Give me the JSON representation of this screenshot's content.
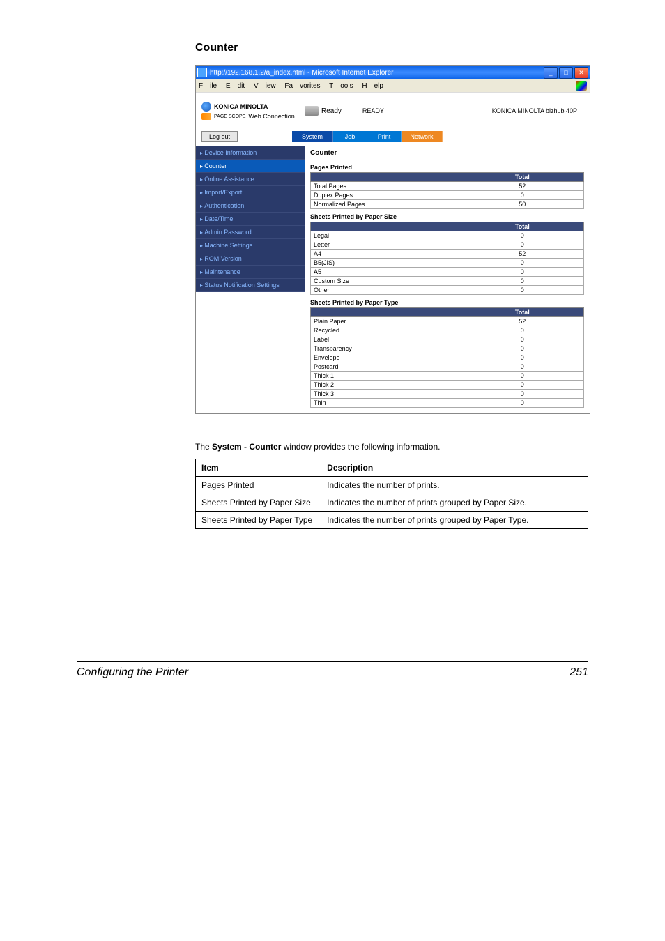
{
  "page": {
    "heading": "Counter"
  },
  "browser": {
    "title": "http://192.168.1.2/a_index.html - Microsoft Internet Explorer",
    "menus": [
      "File",
      "Edit",
      "View",
      "Favorites",
      "Tools",
      "Help"
    ]
  },
  "brand": {
    "name": "KONICA MINOLTA",
    "page_scope": "PAGE SCOPE",
    "web_conn": "Web Connection",
    "status": "Ready",
    "ready": "READY",
    "model": "KONICA MINOLTA bizhub 40P"
  },
  "logout": "Log out",
  "tabs": {
    "system": "System",
    "job": "Job",
    "print": "Print",
    "network": "Network"
  },
  "sidebar": [
    "Device Information",
    "Counter",
    "Online Assistance",
    "Import/Export",
    "Authentication",
    "Date/Time",
    "Admin Password",
    "Machine Settings",
    "ROM Version",
    "Maintenance",
    "Status Notification Settings"
  ],
  "panel": {
    "title": "Counter",
    "sections": {
      "pages": {
        "title": "Pages Printed",
        "total_hdr": "Total",
        "rows": [
          {
            "label": "Total Pages",
            "value": "52"
          },
          {
            "label": "Duplex Pages",
            "value": "0"
          },
          {
            "label": "Normalized Pages",
            "value": "50"
          }
        ]
      },
      "size": {
        "title": "Sheets Printed by Paper Size",
        "total_hdr": "Total",
        "rows": [
          {
            "label": "Legal",
            "value": "0"
          },
          {
            "label": "Letter",
            "value": "0"
          },
          {
            "label": "A4",
            "value": "52"
          },
          {
            "label": "B5(JIS)",
            "value": "0"
          },
          {
            "label": "A5",
            "value": "0"
          },
          {
            "label": "Custom Size",
            "value": "0"
          },
          {
            "label": "Other",
            "value": "0"
          }
        ]
      },
      "type": {
        "title": "Sheets Printed by Paper Type",
        "total_hdr": "Total",
        "rows": [
          {
            "label": "Plain Paper",
            "value": "52"
          },
          {
            "label": "Recycled",
            "value": "0"
          },
          {
            "label": "Label",
            "value": "0"
          },
          {
            "label": "Transparency",
            "value": "0"
          },
          {
            "label": "Envelope",
            "value": "0"
          },
          {
            "label": "Postcard",
            "value": "0"
          },
          {
            "label": "Thick 1",
            "value": "0"
          },
          {
            "label": "Thick 2",
            "value": "0"
          },
          {
            "label": "Thick 3",
            "value": "0"
          },
          {
            "label": "Thin",
            "value": "0"
          }
        ]
      }
    }
  },
  "info": {
    "para_prefix": "The ",
    "para_bold": "System - Counter",
    "para_suffix": " window provides the following information.",
    "headers": {
      "item": "Item",
      "desc": "Description"
    },
    "rows": [
      {
        "item": "Pages Printed",
        "desc": "Indicates the number of prints."
      },
      {
        "item": "Sheets Printed by Paper Size",
        "desc": "Indicates the number of prints grouped by Paper Size."
      },
      {
        "item": "Sheets Printed by Paper Type",
        "desc": "Indicates the number of prints grouped by Paper Type."
      }
    ]
  },
  "footer": {
    "left": "Configuring the Printer",
    "right": "251"
  }
}
